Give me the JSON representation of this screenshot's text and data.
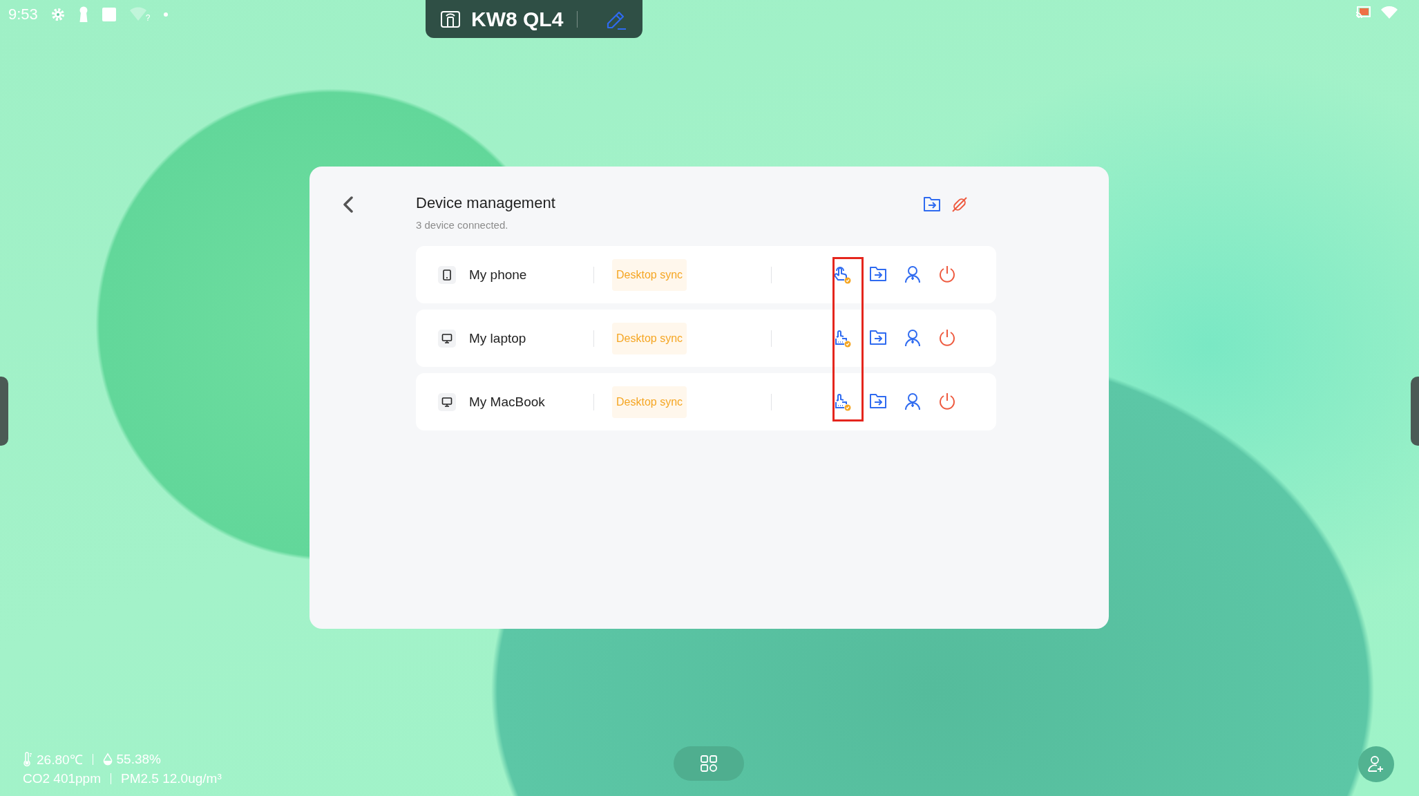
{
  "status_bar": {
    "time": "9:53",
    "wifi_badge": "?"
  },
  "device_pill": {
    "name": "KW8 QL4"
  },
  "panel": {
    "title": "Device management",
    "subtitle": "3 device connected.",
    "devices": [
      {
        "kind": "phone",
        "name": "My phone",
        "tag": "Desktop sync"
      },
      {
        "kind": "computer",
        "name": "My laptop",
        "tag": "Desktop sync"
      },
      {
        "kind": "computer",
        "name": "My MacBook",
        "tag": "Desktop sync"
      }
    ]
  },
  "environment": {
    "temperature": "26.80℃",
    "humidity": "55.38%",
    "co2": "CO2 401ppm",
    "pm25": "PM2.5 12.0ug/m³"
  }
}
